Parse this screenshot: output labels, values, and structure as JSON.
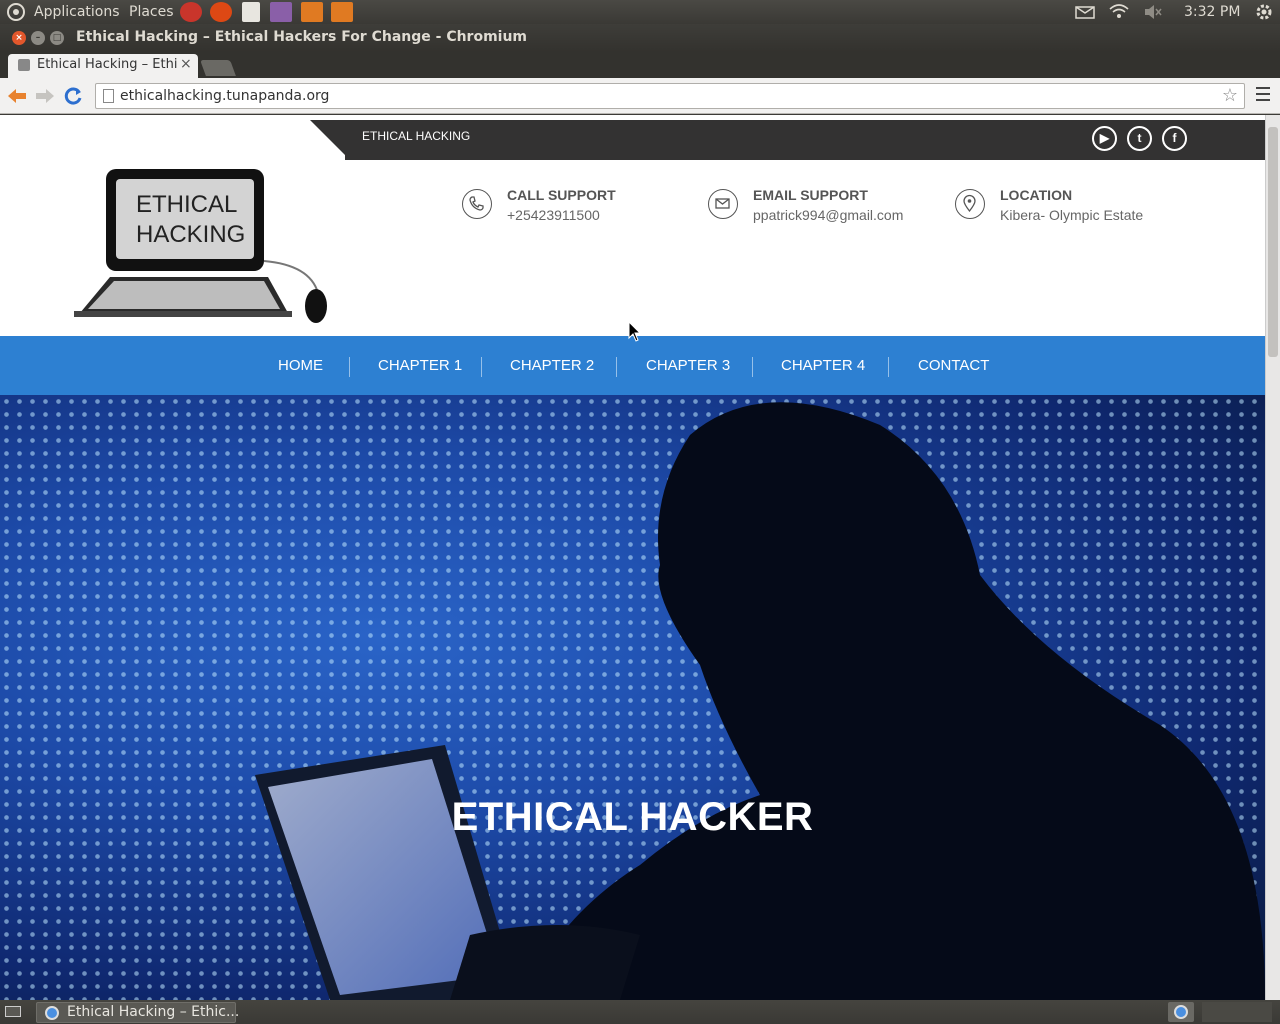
{
  "system_panel": {
    "applications": "Applications",
    "places": "Places",
    "clock": "3:32 PM"
  },
  "window": {
    "title": "Ethical Hacking – Ethical Hackers For Change - Chromium"
  },
  "browser": {
    "tab_title": "Ethical Hacking – Ethi",
    "tab_close": "×",
    "url": "ethicalhacking.tunapanda.org"
  },
  "site": {
    "top_tag": "ETHICAL HACKING",
    "logo_line1": "ETHICAL",
    "logo_line2": "HACKING",
    "social": [
      "youtube-icon",
      "twitter-icon",
      "facebook-icon"
    ],
    "call": {
      "label": "CALL SUPPORT",
      "value": "+25423911500"
    },
    "email": {
      "label": "EMAIL SUPPORT",
      "value": "ppatrick994@gmail.com"
    },
    "location": {
      "label": "LOCATION",
      "value": "Kibera- Olympic Estate"
    },
    "nav": [
      "HOME",
      "CHAPTER 1",
      "CHAPTER 2",
      "CHAPTER 3",
      "CHAPTER 4",
      "CONTACT"
    ],
    "hero_title": "ETHICAL HACKER"
  },
  "taskbar": {
    "task_label": "Ethical Hacking – Ethic..."
  },
  "colors": {
    "nav_bg": "#2d80d2",
    "top_strip": "#333232"
  }
}
